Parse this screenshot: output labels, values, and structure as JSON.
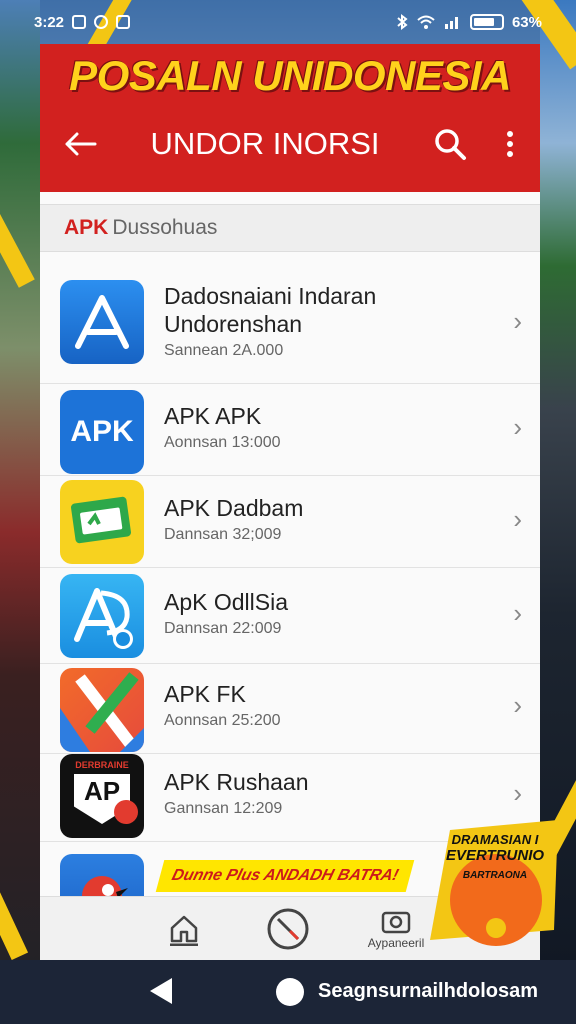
{
  "status_bar": {
    "time": "3:22",
    "battery_text": "63%"
  },
  "header": {
    "banner_title": "POSALN UNIDONESIA",
    "toolbar_title": "UNDOR INORSI",
    "accent_color": "#d2211f",
    "banner_color": "#ffd21c"
  },
  "section": {
    "tag": "APK",
    "label": "Dussohuas"
  },
  "apps": [
    {
      "title": "Dadosnaiani Indaran Undorenshan",
      "subtitle": "Sannean 2A.000",
      "icon": "triangle-a-icon"
    },
    {
      "title": "APK APK",
      "subtitle": "Aonnsan 13:000",
      "icon": "apk-text-icon"
    },
    {
      "title": "APK Dadbam",
      "subtitle": "Dannsan 32;009",
      "icon": "green-card-icon"
    },
    {
      "title": "ApK OdllSia",
      "subtitle": "Dannsan 22:009",
      "icon": "blue-a-icon"
    },
    {
      "title": "APK FK",
      "subtitle": "Aonnsan 25:200",
      "icon": "x-logo-icon"
    },
    {
      "title": "APK Rushaan",
      "subtitle": "Gannsan 12:209",
      "icon": "shield-ap-icon"
    }
  ],
  "icon_labels": {
    "apk_text": "APK",
    "shield_ap": "AP",
    "shield_top": "DERBRAINE"
  },
  "bottom_nav": {
    "third_label": "Aypaneeril"
  },
  "promo": {
    "strip_text": "Dunne Plus ANDADH BATRA!",
    "badge_line1": "DRAMASIAN I",
    "badge_line2": "EVERTRUNIO",
    "badge_line3": "BARTRAONA"
  },
  "system_nav": {
    "text": "Seagnsurnailhdolosam"
  }
}
